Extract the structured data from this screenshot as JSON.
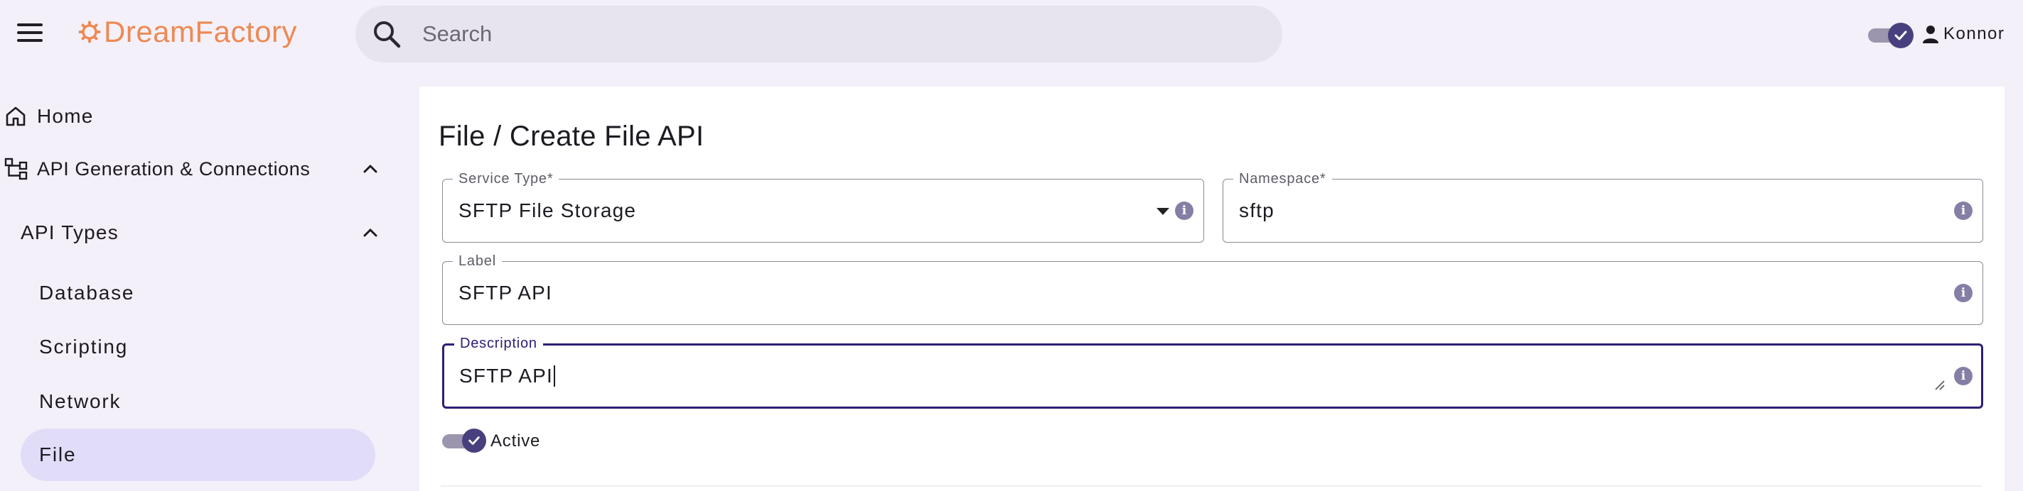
{
  "header": {
    "brand": "DreamFactory",
    "search_placeholder": "Search",
    "user_name": "Konnor"
  },
  "sidebar": {
    "home": "Home",
    "api_generation": "API Generation & Connections",
    "api_types": "API Types",
    "items": [
      {
        "label": "Database",
        "active": false
      },
      {
        "label": "Scripting",
        "active": false
      },
      {
        "label": "Network",
        "active": false
      },
      {
        "label": "File",
        "active": true
      }
    ]
  },
  "main": {
    "title": "File / Create File API",
    "service_type": {
      "label": "Service Type*",
      "value": "SFTP File Storage"
    },
    "namespace": {
      "label": "Namespace*",
      "value": "sftp"
    },
    "label_field": {
      "label": "Label",
      "value": "SFTP API"
    },
    "description": {
      "label": "Description",
      "value": "SFTP API"
    },
    "active_label": "Active",
    "info_glyph": "i"
  },
  "colors": {
    "brand": "#ec8a55",
    "accent": "#2b2175",
    "active_nav_bg": "#e1dcf8",
    "toggle_thumb": "#48407e"
  }
}
